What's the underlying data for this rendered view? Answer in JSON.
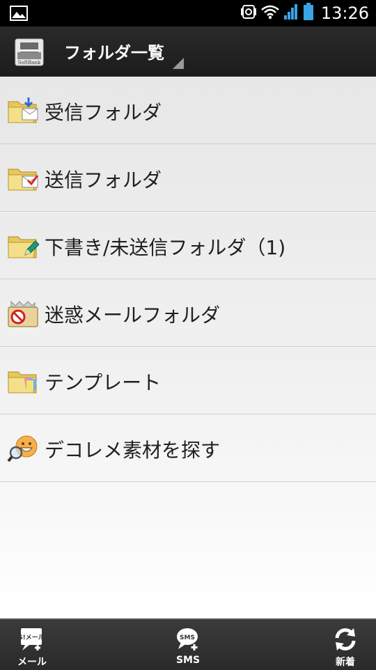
{
  "status_bar": {
    "time": "13:26"
  },
  "action_bar": {
    "title": "フォルダ一覧",
    "app_icon_text": "SoftBank"
  },
  "folders": [
    {
      "label": "受信フォルダ",
      "icon": "inbox-folder-icon"
    },
    {
      "label": "送信フォルダ",
      "icon": "sent-folder-icon"
    },
    {
      "label": "下書き/未送信フォルダ（1)",
      "icon": "drafts-folder-icon"
    },
    {
      "label": "迷惑メールフォルダ",
      "icon": "spam-folder-icon"
    },
    {
      "label": "テンプレート",
      "icon": "template-folder-icon"
    },
    {
      "label": "デコレメ素材を探す",
      "icon": "search-decoration-icon"
    }
  ],
  "bottom_bar": {
    "mail_label": "メール",
    "mail_icon_text": "S!メール",
    "sms_label": "SMS",
    "sms_icon_text": "SMS",
    "new_label": "新着"
  }
}
